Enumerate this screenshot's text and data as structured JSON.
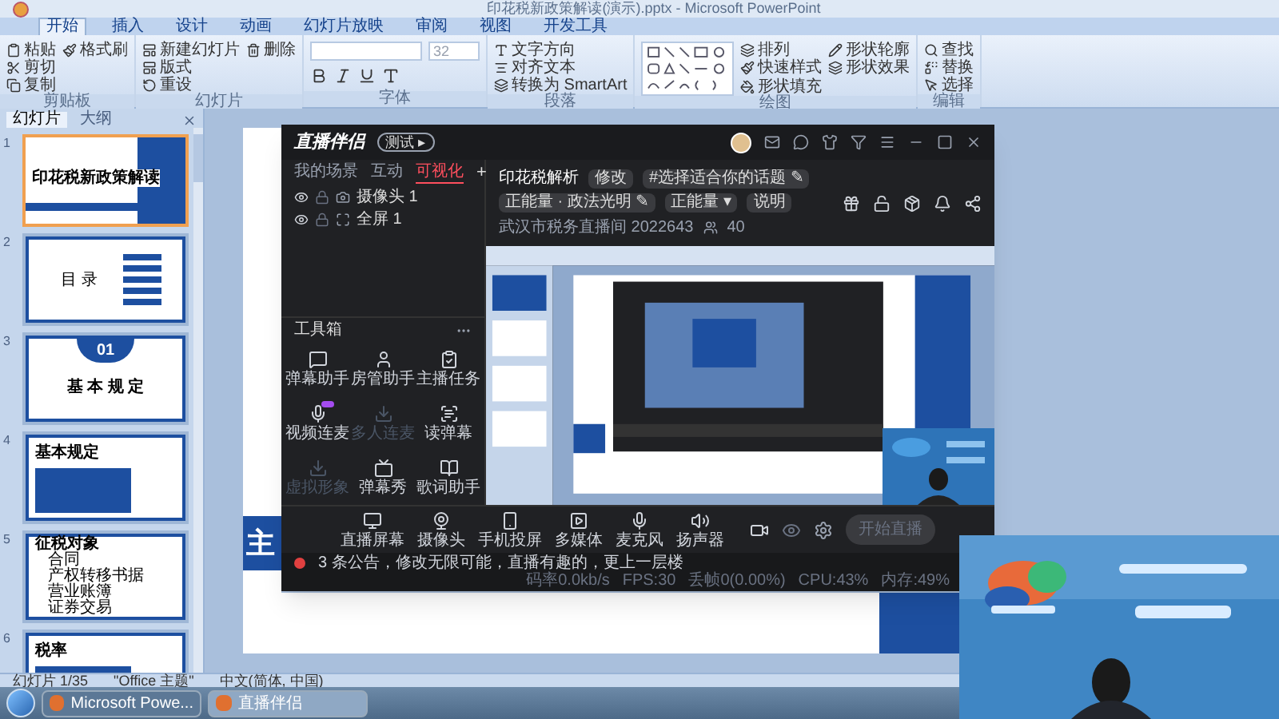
{
  "titlebar": {
    "title": "印花税新政策解读(演示).pptx - Microsoft PowerPoint"
  },
  "ribbon": {
    "tabs": [
      {
        "label": "开始",
        "selected": true
      },
      {
        "label": "插入",
        "selected": false
      },
      {
        "label": "设计",
        "selected": false
      },
      {
        "label": "动画",
        "selected": false
      },
      {
        "label": "幻灯片放映",
        "selected": false
      },
      {
        "label": "审阅",
        "selected": false
      },
      {
        "label": "视图",
        "selected": false
      },
      {
        "label": "开发工具",
        "selected": false
      }
    ],
    "groups": [
      {
        "kind": "buttons",
        "label": "剪贴板",
        "items": [
          "粘贴",
          "剪切",
          "复制",
          "格式刷"
        ]
      },
      {
        "kind": "buttons",
        "label": "幻灯片",
        "items": [
          "新建幻灯片",
          "版式",
          "重设",
          "删除"
        ]
      },
      {
        "kind": "font",
        "label": "字体",
        "items": [
          "32"
        ]
      },
      {
        "kind": "buttons",
        "label": "段落",
        "items": [
          "文字方向",
          "对齐文本",
          "转换为 SmartArt"
        ]
      },
      {
        "kind": "shapes",
        "label": "绘图",
        "items": [
          "排列",
          "快速样式",
          "形状填充",
          "形状轮廓",
          "形状效果"
        ]
      },
      {
        "kind": "buttons",
        "label": "编辑",
        "items": [
          "查找",
          "替换",
          "选择"
        ]
      }
    ]
  },
  "slides_panel": {
    "tabs": [
      {
        "label": "幻灯片",
        "selected": true
      },
      {
        "label": "大纲",
        "selected": false
      }
    ],
    "slides": [
      {
        "number": "1",
        "selected": true,
        "kind": "title",
        "title": "印花税新政策解读"
      },
      {
        "number": "2",
        "selected": false,
        "kind": "toc",
        "title": "目 录"
      },
      {
        "number": "3",
        "selected": false,
        "kind": "section",
        "badge": "01",
        "title": "基 本 规 定"
      },
      {
        "number": "4",
        "selected": false,
        "kind": "content",
        "title": "基本规定"
      },
      {
        "number": "5",
        "selected": false,
        "kind": "list",
        "title": "征税对象",
        "items": [
          "合同",
          "产权转移书据",
          "营业账簿",
          "证券交易"
        ]
      },
      {
        "number": "6",
        "selected": false,
        "kind": "content",
        "title": "税率"
      }
    ]
  },
  "slide": {
    "visible_text": "主"
  },
  "status_bar": [
    "幻灯片 1/35",
    "\"Office 主题\"",
    "中文(简体, 中国)"
  ],
  "taskbar": [
    {
      "label": "Microsoft Powe...",
      "selected": false
    },
    {
      "label": "直播伴侣",
      "selected": true
    }
  ],
  "stream_app": {
    "logo": "直播伴侣",
    "badge": "测试 ▸",
    "left_tabs": [
      {
        "label": "我的场景",
        "selected": false
      },
      {
        "label": "互动",
        "selected": false
      },
      {
        "label": "可视化",
        "selected": true
      }
    ],
    "add": "+",
    "sources": [
      {
        "label": "摄像头 1",
        "visible": true
      },
      {
        "label": "全屏 1",
        "visible": true
      }
    ],
    "toolbox_title": "工具箱",
    "tools": [
      {
        "label": "弹幕助手",
        "disabled": false,
        "tagged": false
      },
      {
        "label": "房管助手",
        "disabled": false,
        "tagged": false
      },
      {
        "label": "主播任务",
        "disabled": false,
        "tagged": false
      },
      {
        "label": "视频连麦",
        "disabled": false,
        "tagged": true
      },
      {
        "label": "多人连麦",
        "disabled": true,
        "tagged": false
      },
      {
        "label": "读弹幕",
        "disabled": false,
        "tagged": false
      },
      {
        "label": "虚拟形象",
        "disabled": true,
        "tagged": false
      },
      {
        "label": "弹幕秀",
        "disabled": false,
        "tagged": false
      },
      {
        "label": "歌词助手",
        "disabled": false,
        "tagged": false
      }
    ],
    "title": "印花税解析",
    "edit": "修改",
    "topic": "#选择适合你的话题 ✎",
    "category": "正能量 · 政法光明 ✎",
    "tag": "正能量 ▾",
    "note": "说明",
    "room": "武汉市税务直播间 2022643",
    "viewers": "40",
    "controls": [
      "直播屏幕",
      "摄像头",
      "手机投屏",
      "多媒体",
      "麦克风",
      "扬声器"
    ],
    "start": "开始直播",
    "notice": "3 条公告，修改无限可能，直播有趣的，更上一层楼",
    "stats": [
      "码率0.0kb/s",
      "FPS:30",
      "丢帧0(0.00%)",
      "CPU:43%",
      "内存:49%"
    ]
  },
  "webcam": {
    "kind": "picture"
  }
}
